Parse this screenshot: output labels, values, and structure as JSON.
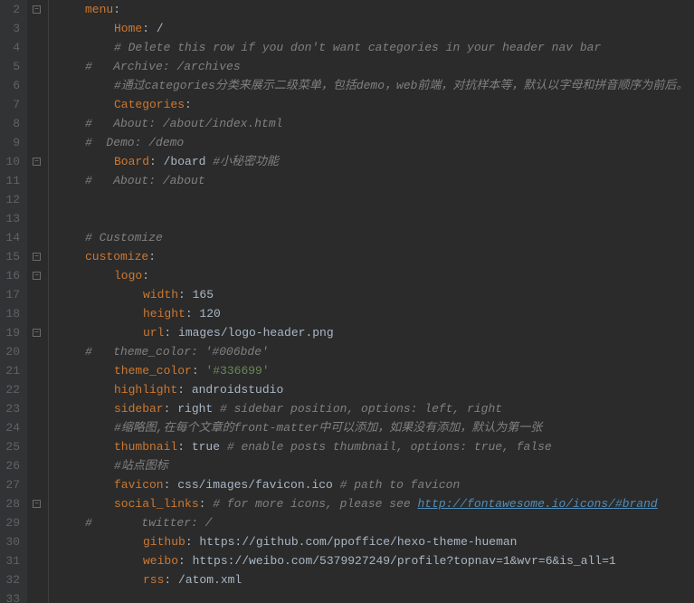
{
  "lines": [
    {
      "num": 2,
      "indent": 0,
      "segs": [
        {
          "t": "menu",
          "c": "c-key"
        },
        {
          "t": ":",
          "c": "c-colon"
        }
      ],
      "fold": true
    },
    {
      "num": 3,
      "indent": 2,
      "segs": [
        {
          "t": "Home",
          "c": "c-key"
        },
        {
          "t": ": ",
          "c": "c-colon"
        },
        {
          "t": "/",
          "c": "c-val"
        }
      ]
    },
    {
      "num": 4,
      "indent": 2,
      "segs": [
        {
          "t": "# Delete this row if you don't want categories in your header nav bar",
          "c": "c-comment"
        }
      ]
    },
    {
      "num": 5,
      "indent": 0,
      "segs": [
        {
          "t": "#   Archive: /archives",
          "c": "c-comment"
        }
      ]
    },
    {
      "num": 6,
      "indent": 2,
      "segs": [
        {
          "t": "#通过categories分类来展示二级菜单，包括demo，web前端，对抗样本等，默认以字母和拼音顺序为前后。",
          "c": "c-comment"
        }
      ]
    },
    {
      "num": 7,
      "indent": 2,
      "segs": [
        {
          "t": "Categories",
          "c": "c-key"
        },
        {
          "t": ":",
          "c": "c-colon"
        }
      ]
    },
    {
      "num": 8,
      "indent": 0,
      "segs": [
        {
          "t": "#   About: /about/index.html",
          "c": "c-comment"
        }
      ]
    },
    {
      "num": 9,
      "indent": 0,
      "segs": [
        {
          "t": "#  Demo: /demo",
          "c": "c-comment"
        }
      ]
    },
    {
      "num": 10,
      "indent": 2,
      "segs": [
        {
          "t": "Board",
          "c": "c-key"
        },
        {
          "t": ": ",
          "c": "c-colon"
        },
        {
          "t": "/board ",
          "c": "c-val"
        },
        {
          "t": "#小秘密功能",
          "c": "c-comment"
        }
      ],
      "fold": true
    },
    {
      "num": 11,
      "indent": 0,
      "segs": [
        {
          "t": "#   About: /about",
          "c": "c-comment"
        }
      ]
    },
    {
      "num": 12,
      "indent": 0,
      "segs": []
    },
    {
      "num": 13,
      "indent": 0,
      "segs": []
    },
    {
      "num": 14,
      "indent": 0,
      "segs": [
        {
          "t": "# Customize",
          "c": "c-comment"
        }
      ]
    },
    {
      "num": 15,
      "indent": 0,
      "segs": [
        {
          "t": "customize",
          "c": "c-key"
        },
        {
          "t": ":",
          "c": "c-colon"
        }
      ],
      "fold": true
    },
    {
      "num": 16,
      "indent": 2,
      "segs": [
        {
          "t": "logo",
          "c": "c-key"
        },
        {
          "t": ":",
          "c": "c-colon"
        }
      ],
      "fold": true
    },
    {
      "num": 17,
      "indent": 4,
      "segs": [
        {
          "t": "width",
          "c": "c-key"
        },
        {
          "t": ": ",
          "c": "c-colon"
        },
        {
          "t": "165",
          "c": "c-val"
        }
      ]
    },
    {
      "num": 18,
      "indent": 4,
      "segs": [
        {
          "t": "height",
          "c": "c-key"
        },
        {
          "t": ": ",
          "c": "c-colon"
        },
        {
          "t": "120",
          "c": "c-val"
        }
      ]
    },
    {
      "num": 19,
      "indent": 4,
      "segs": [
        {
          "t": "url",
          "c": "c-key"
        },
        {
          "t": ": ",
          "c": "c-colon"
        },
        {
          "t": "images/logo-header.png",
          "c": "c-val"
        }
      ],
      "fold": true
    },
    {
      "num": 20,
      "indent": 0,
      "segs": [
        {
          "t": "#   theme_color: '#006bde'",
          "c": "c-comment"
        }
      ]
    },
    {
      "num": 21,
      "indent": 2,
      "segs": [
        {
          "t": "theme_color",
          "c": "c-key"
        },
        {
          "t": ": ",
          "c": "c-colon"
        },
        {
          "t": "'#336699'",
          "c": "c-str"
        }
      ]
    },
    {
      "num": 22,
      "indent": 2,
      "segs": [
        {
          "t": "highlight",
          "c": "c-key"
        },
        {
          "t": ": ",
          "c": "c-colon"
        },
        {
          "t": "androidstudio",
          "c": "c-val"
        }
      ]
    },
    {
      "num": 23,
      "indent": 2,
      "segs": [
        {
          "t": "sidebar",
          "c": "c-key"
        },
        {
          "t": ": ",
          "c": "c-colon"
        },
        {
          "t": "right ",
          "c": "c-val"
        },
        {
          "t": "# sidebar position, options: left, right",
          "c": "c-comment"
        }
      ]
    },
    {
      "num": 24,
      "indent": 2,
      "segs": [
        {
          "t": "#缩略图,在每个文章的front-matter中可以添加，如果没有添加，默认为第一张",
          "c": "c-comment"
        }
      ]
    },
    {
      "num": 25,
      "indent": 2,
      "segs": [
        {
          "t": "thumbnail",
          "c": "c-key"
        },
        {
          "t": ": ",
          "c": "c-colon"
        },
        {
          "t": "true ",
          "c": "c-val"
        },
        {
          "t": "# enable posts thumbnail, options: true, false",
          "c": "c-comment"
        }
      ]
    },
    {
      "num": 26,
      "indent": 2,
      "segs": [
        {
          "t": "#站点图标",
          "c": "c-comment"
        }
      ]
    },
    {
      "num": 27,
      "indent": 2,
      "segs": [
        {
          "t": "favicon",
          "c": "c-key"
        },
        {
          "t": ": ",
          "c": "c-colon"
        },
        {
          "t": "css/images/favicon.ico ",
          "c": "c-val"
        },
        {
          "t": "# path to favicon",
          "c": "c-comment"
        }
      ]
    },
    {
      "num": 28,
      "indent": 2,
      "segs": [
        {
          "t": "social_links",
          "c": "c-key"
        },
        {
          "t": ": ",
          "c": "c-colon"
        },
        {
          "t": "# for more icons, please see ",
          "c": "c-comment"
        },
        {
          "t": "http://fontawesome.io/icons/#brand",
          "c": "c-url"
        }
      ],
      "fold": true
    },
    {
      "num": 29,
      "indent": 0,
      "segs": [
        {
          "t": "#       twitter: /",
          "c": "c-comment"
        }
      ]
    },
    {
      "num": 30,
      "indent": 4,
      "segs": [
        {
          "t": "github",
          "c": "c-key"
        },
        {
          "t": ": ",
          "c": "c-colon"
        },
        {
          "t": "https://github.com/ppoffice/hexo-theme-hueman",
          "c": "c-val"
        }
      ]
    },
    {
      "num": 31,
      "indent": 4,
      "segs": [
        {
          "t": "weibo",
          "c": "c-key"
        },
        {
          "t": ": ",
          "c": "c-colon"
        },
        {
          "t": "https://weibo.com/5379927249/profile?topnav=1&wvr=6&is_all=1",
          "c": "c-val"
        }
      ]
    },
    {
      "num": 32,
      "indent": 4,
      "segs": [
        {
          "t": "rss",
          "c": "c-key"
        },
        {
          "t": ": ",
          "c": "c-colon"
        },
        {
          "t": "/atom.xml",
          "c": "c-val"
        }
      ]
    },
    {
      "num": 33,
      "indent": 0,
      "segs": []
    }
  ]
}
